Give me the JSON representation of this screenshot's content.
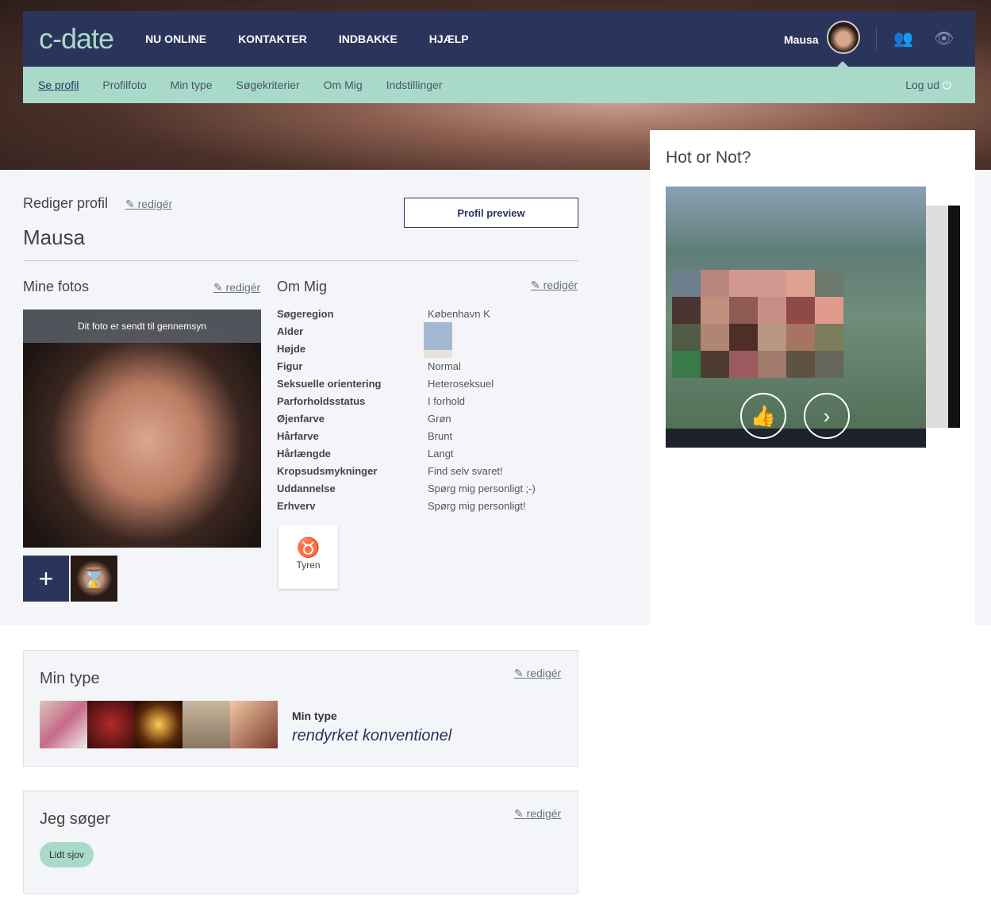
{
  "nav": {
    "logo": "c-date",
    "items": [
      "NU ONLINE",
      "KONTAKTER",
      "INDBAKKE",
      "HJÆLP"
    ],
    "user": "Mausa",
    "icons": [
      "contacts-icon",
      "eye-icon"
    ]
  },
  "subnav": {
    "items": [
      "Se profil",
      "Profilfoto",
      "Min type",
      "Søgekriterier",
      "Om Mig",
      "Indstillinger"
    ],
    "logout": "Log ud"
  },
  "profile": {
    "heading": "Rediger profil",
    "edit": "redigér",
    "name": "Mausa",
    "preview": "Profil preview"
  },
  "photos": {
    "heading": "Mine fotos",
    "edit": "redigér",
    "banner": "Dit foto er sendt til gennemsyn",
    "add": "+"
  },
  "about": {
    "heading": "Om Mig",
    "edit": "redigér",
    "rows": [
      {
        "label": "Søgeregion",
        "value": "København K"
      },
      {
        "label": "Alder",
        "value": ""
      },
      {
        "label": "Højde",
        "value": ""
      },
      {
        "label": "Figur",
        "value": "Normal"
      },
      {
        "label": "Seksuelle orientering",
        "value": "Heteroseksuel"
      },
      {
        "label": "Parforholdsstatus",
        "value": "I forhold"
      },
      {
        "label": "Øjenfarve",
        "value": "Grøn"
      },
      {
        "label": "Hårfarve",
        "value": "Brunt"
      },
      {
        "label": "Hårlængde",
        "value": "Langt"
      },
      {
        "label": "Kropsudsmykninger",
        "value": "Find selv svaret!"
      },
      {
        "label": "Uddannelse",
        "value": "Spørg mig personligt ;-)"
      },
      {
        "label": "Erhverv",
        "value": "Spørg mig personligt!"
      }
    ],
    "zodiac": {
      "symbol": "♉",
      "label": "Tyren"
    }
  },
  "hot": {
    "heading": "Hot or Not?"
  },
  "mintype": {
    "heading": "Min type",
    "edit": "redigér",
    "label": "Min type",
    "value": "rendyrket konventionel"
  },
  "seeking": {
    "heading": "Jeg søger",
    "edit": "redigér",
    "tags": [
      "Lidt sjov"
    ]
  }
}
